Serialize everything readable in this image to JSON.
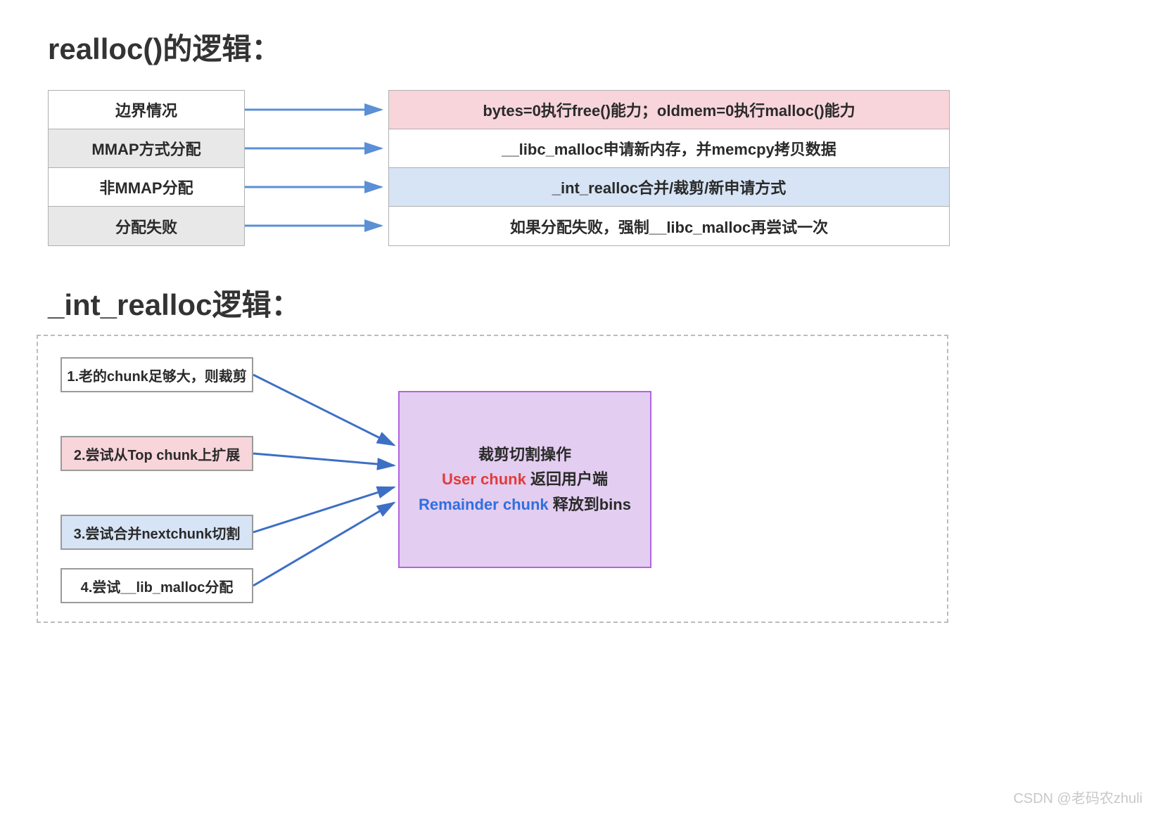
{
  "titles": {
    "realloc": "realloc()的逻辑：",
    "int_realloc": "_int_realloc逻辑："
  },
  "top_left": [
    {
      "label": "边界情况",
      "bg": "bg-white"
    },
    {
      "label": "MMAP方式分配",
      "bg": "bg-gray"
    },
    {
      "label": "非MMAP分配",
      "bg": "bg-white"
    },
    {
      "label": "分配失败",
      "bg": "bg-gray"
    }
  ],
  "top_right": [
    {
      "label": "bytes=0执行free()能力；oldmem=0执行malloc()能力",
      "bg": "bg-pink"
    },
    {
      "label": "__libc_malloc申请新内存，并memcpy拷贝数据",
      "bg": "bg-white"
    },
    {
      "label": "_int_realloc合并/裁剪/新申请方式",
      "bg": "bg-blue"
    },
    {
      "label": "如果分配失败，强制__libc_malloc再尝试一次",
      "bg": "bg-white"
    }
  ],
  "steps": [
    "1.老的chunk足够大，则裁剪",
    "2.尝试从Top chunk上扩展",
    "3.尝试合并nextchunk切割",
    "4.尝试__lib_malloc分配"
  ],
  "purple": {
    "line1": "裁剪切割操作",
    "line2_red": "User chunk",
    "line2_rest": " 返回用户端",
    "line3_blue": "Remainder chunk",
    "line3_rest": " 释放到bins"
  },
  "colors": {
    "arrow_top": "#5b8fd6",
    "arrow_bottom": "#3d6fc5"
  },
  "watermark": "CSDN @老码农zhuli"
}
